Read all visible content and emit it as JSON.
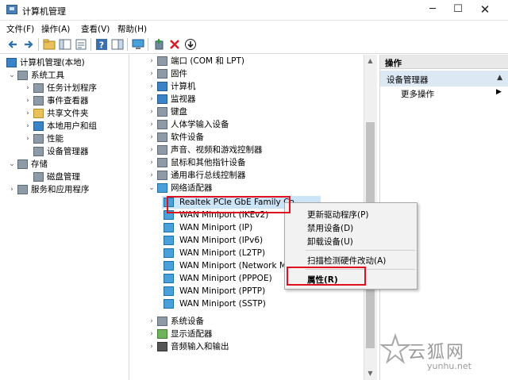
{
  "window": {
    "title": "计算机管理",
    "minimize_glyph": "─",
    "maximize_glyph": "☐",
    "close_glyph": "✕"
  },
  "menu": {
    "items": [
      "文件(F)",
      "操作(A)",
      "查看(V)",
      "帮助(H)"
    ]
  },
  "toolbar": {
    "buttons": [
      "back-arrow-icon",
      "forward-arrow-icon",
      "up-folder-icon",
      "show-hide-tree-icon",
      "properties-icon",
      "help-icon",
      "show-action-pane-icon",
      "computer-monitor-icon",
      "add-driver-icon",
      "delete-icon",
      "download-icon"
    ],
    "delete_color": "#d8202a"
  },
  "tree": {
    "root": "计算机管理(本地)",
    "system_tools": "系统工具",
    "task_scheduler": "任务计划程序",
    "event_viewer": "事件查看器",
    "shared_folders": "共享文件夹",
    "local_users": "本地用户和组",
    "performance": "性能",
    "device_manager": "设备管理器",
    "storage": "存储",
    "disk_management": "磁盘管理",
    "services": "服务和应用程序"
  },
  "devices": {
    "ports": "端口 (COM 和 LPT)",
    "firmware": "固件",
    "computer": "计算机",
    "monitors": "监视器",
    "keyboards": "键盘",
    "hid": "人体学输入设备",
    "software_devices": "软件设备",
    "sound": "声音、视频和游戏控制器",
    "mice": "鼠标和其他指针设备",
    "usb": "通用串行总线控制器",
    "network_adapters": "网络适配器",
    "adapter_items": [
      "Realtek PCIe GbE Family Co",
      "WAN Miniport (IKEv2)",
      "WAN Miniport (IP)",
      "WAN Miniport (IPv6)",
      "WAN Miniport (L2TP)",
      "WAN Miniport (Network M",
      "WAN Miniport (PPPOE)",
      "WAN Miniport (PPTP)",
      "WAN Miniport (SSTP)"
    ],
    "system_devices": "系统设备",
    "display_adapters": "显示适配器",
    "audio_io": "音频输入和输出"
  },
  "context_menu": {
    "update_driver": "更新驱动程序(P)",
    "disable_device": "禁用设备(D)",
    "uninstall_device": "卸载设备(U)",
    "scan_hardware": "扫描检测硬件改动(A)",
    "properties": "属性(R)"
  },
  "actions": {
    "header": "操作",
    "section": "设备管理器",
    "more": "更多操作"
  },
  "watermark": {
    "text": "云狐网",
    "url": "yunhu.net"
  },
  "colors": {
    "highlight_red": "#e0101e",
    "action_section_bg": "#dde8f5"
  }
}
